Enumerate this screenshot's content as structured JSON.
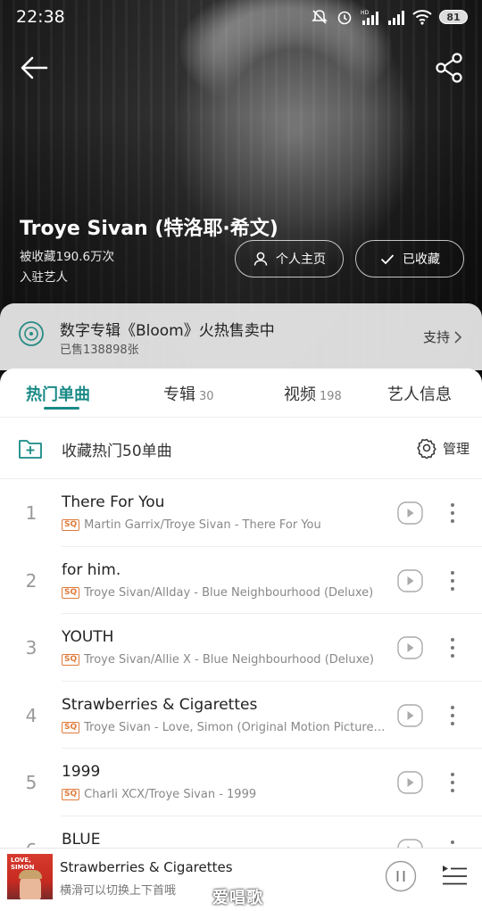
{
  "status_bar": {
    "time": "22:38",
    "battery": "81"
  },
  "artist": {
    "name": "Troye Sivan (特洛耶·希文)",
    "favorites": "被收藏190.6万次",
    "tag": "入驻艺人",
    "home_button": "个人主页",
    "collected_button": "已收藏"
  },
  "promo": {
    "title": "数字专辑《Bloom》火热售卖中",
    "sold": "已售138898张",
    "support": "支持"
  },
  "tabs": [
    {
      "label": "热门单曲",
      "count": ""
    },
    {
      "label": "专辑",
      "count": "30"
    },
    {
      "label": "视频",
      "count": "198"
    },
    {
      "label": "艺人信息",
      "count": ""
    }
  ],
  "collect": {
    "label": "收藏热门50单曲",
    "manage": "管理"
  },
  "songs": [
    {
      "num": "1",
      "title": "There For You",
      "badge": "SQ",
      "meta": "Martin Garrix/Troye Sivan - There For You"
    },
    {
      "num": "2",
      "title": "for him.",
      "badge": "SQ",
      "meta": "Troye Sivan/Allday - Blue Neighbourhood (Deluxe)"
    },
    {
      "num": "3",
      "title": "YOUTH",
      "badge": "SQ",
      "meta": "Troye Sivan/Allie X - Blue Neighbourhood (Deluxe)"
    },
    {
      "num": "4",
      "title": "Strawberries & Cigarettes",
      "badge": "SQ",
      "meta": "Troye Sivan - Love, Simon (Original Motion Picture Soundtrack)"
    },
    {
      "num": "5",
      "title": "1999",
      "badge": "SQ",
      "meta": "Charli XCX/Troye Sivan - 1999"
    },
    {
      "num": "6",
      "title": "BLUE",
      "badge": "",
      "meta": ""
    }
  ],
  "player": {
    "cover_text": "LOVE, SIMON",
    "title": "Strawberries & Cigarettes",
    "hint": "横滑可以切换上下首哦"
  },
  "watermark": "爱唱歌",
  "colors": {
    "accent": "#1a8a86",
    "sq_badge": "#e07a3a"
  }
}
